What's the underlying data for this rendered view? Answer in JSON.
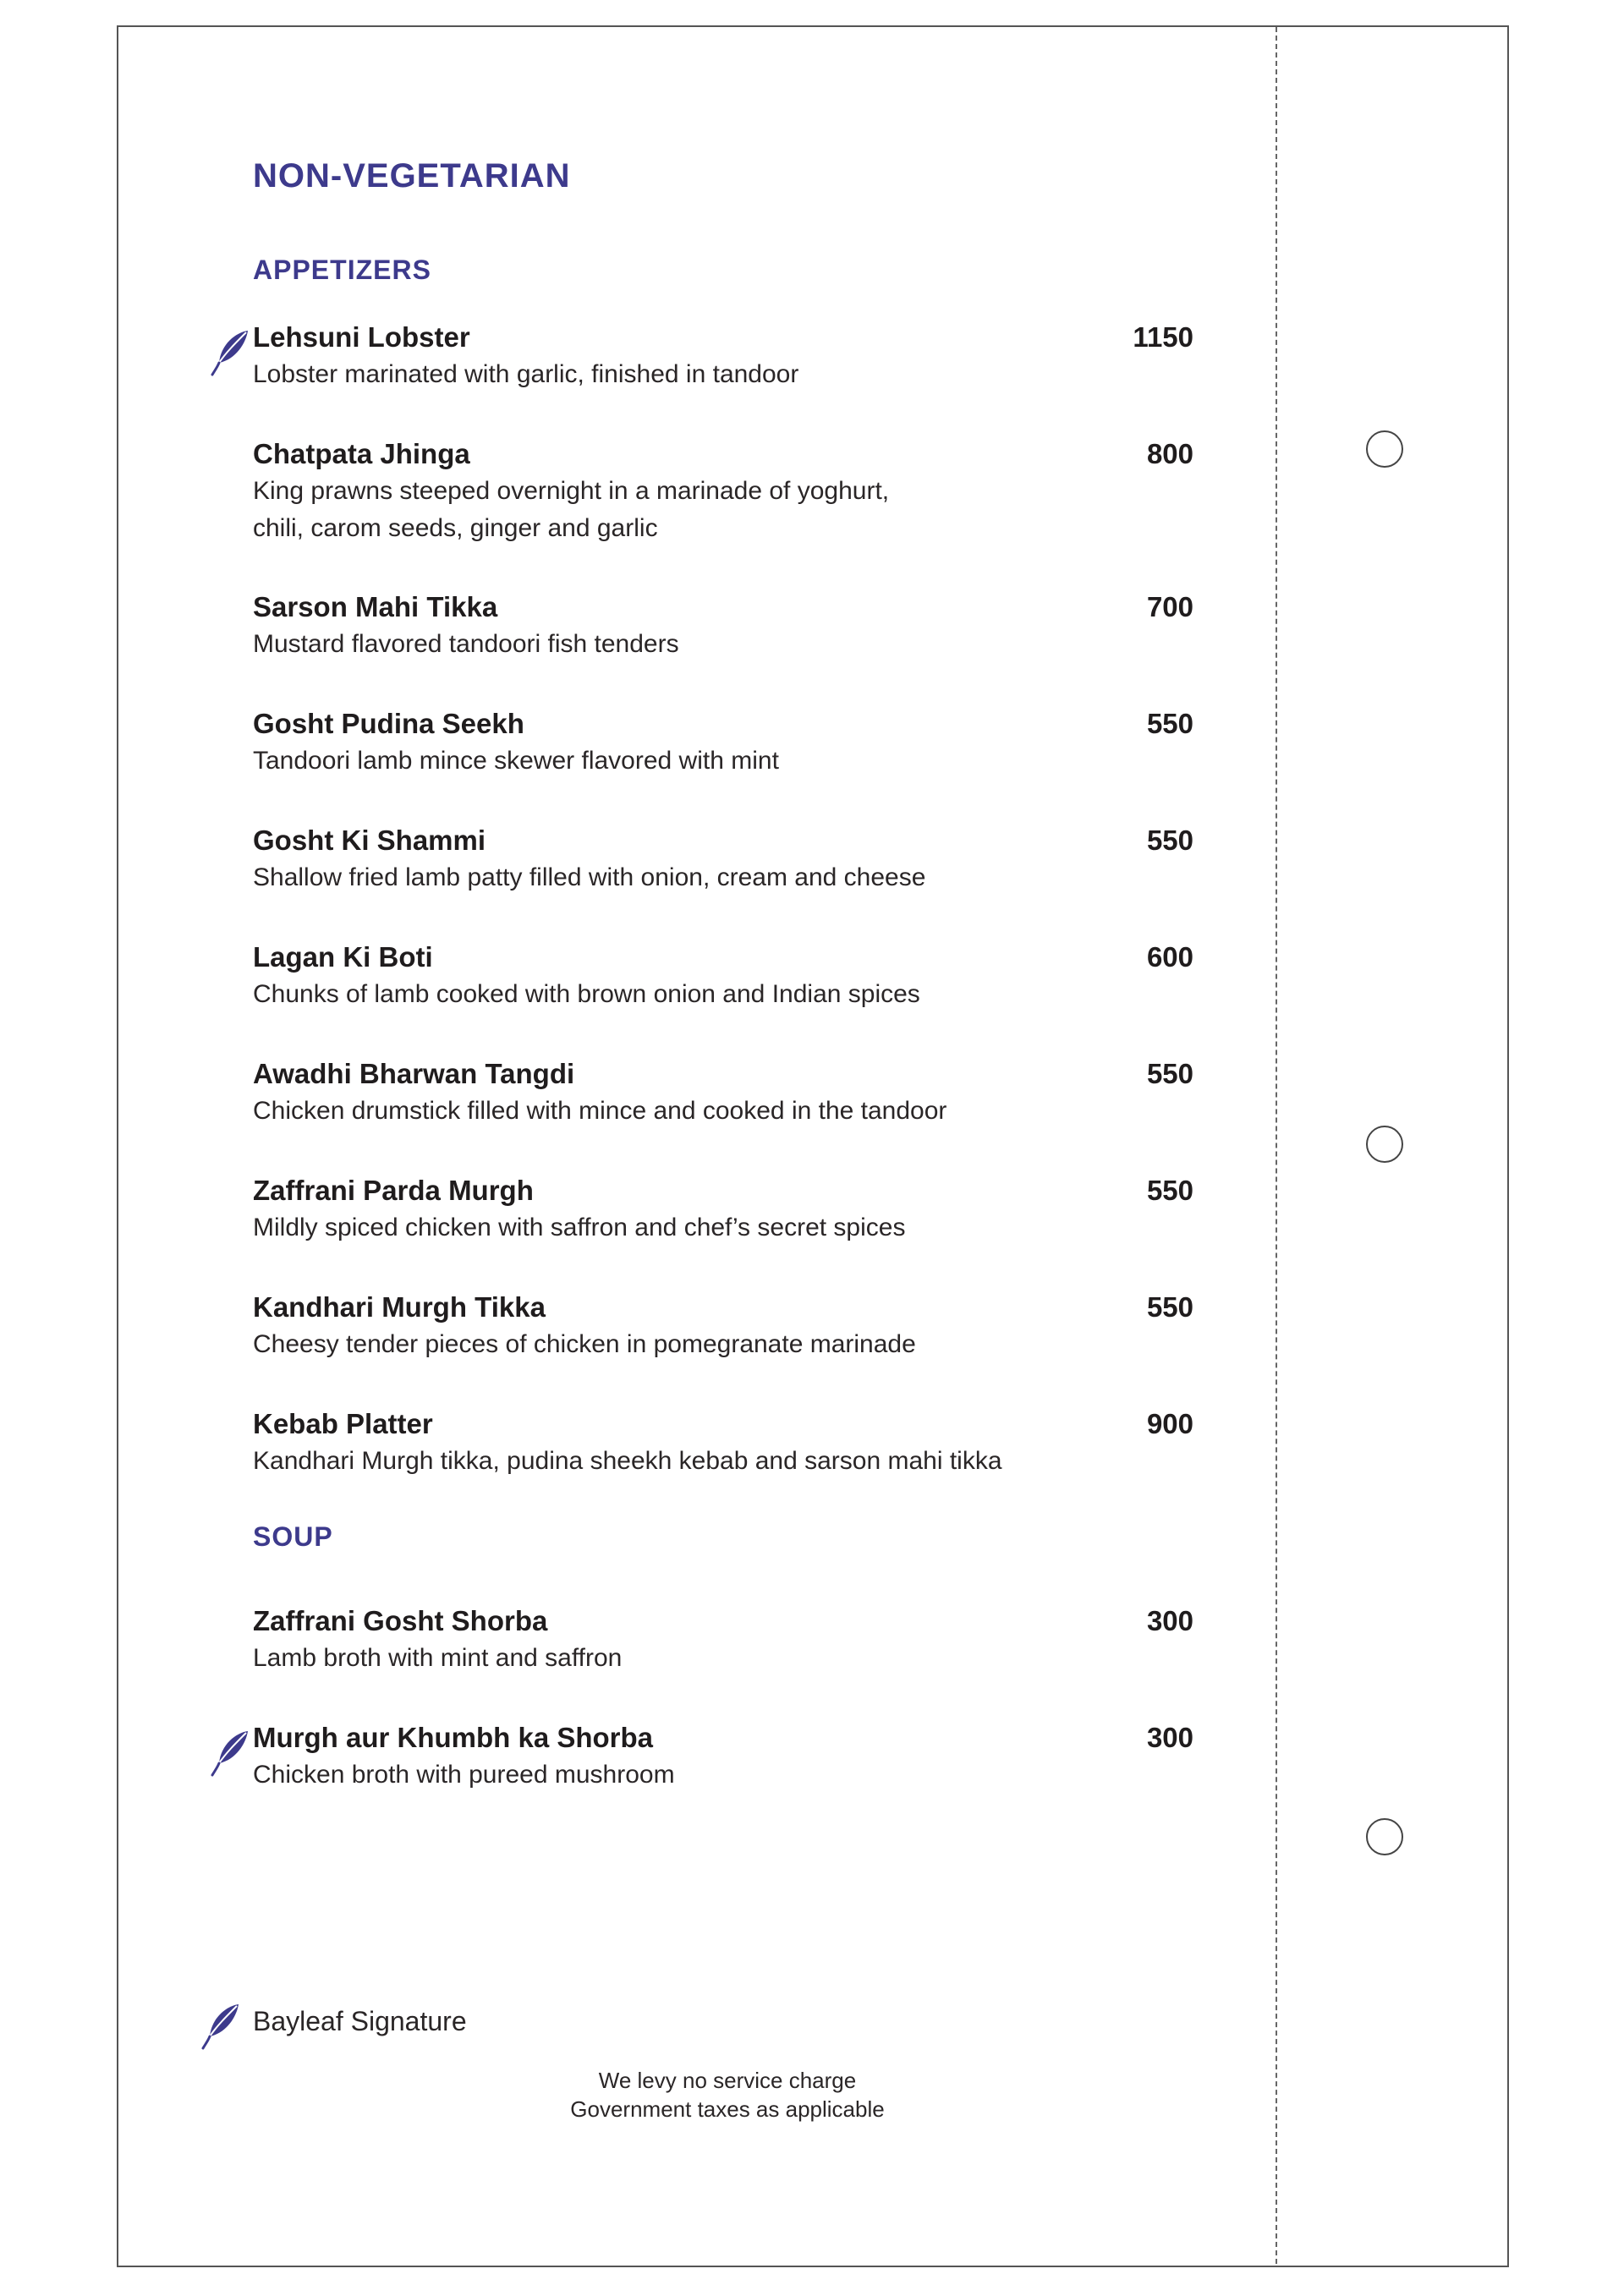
{
  "menu": {
    "title": "NON-VEGETARIAN",
    "sections": [
      {
        "heading": "APPETIZERS",
        "items": [
          {
            "name": "Lehsuni Lobster",
            "description": "Lobster marinated with garlic, finished in tandoor",
            "price": "1150",
            "signature": true
          },
          {
            "name": "Chatpata Jhinga",
            "description": "King prawns steeped overnight in a marinade of yoghurt,\nchili, carom seeds, ginger and garlic",
            "price": "800",
            "signature": false
          },
          {
            "name": "Sarson Mahi Tikka",
            "description": "Mustard flavored tandoori fish tenders",
            "price": "700",
            "signature": false
          },
          {
            "name": "Gosht Pudina Seekh",
            "description": "Tandoori  lamb mince skewer flavored with mint",
            "price": "550",
            "signature": false
          },
          {
            "name": "Gosht Ki Shammi",
            "description": "Shallow fried lamb patty filled with onion, cream and cheese",
            "price": "550",
            "signature": false
          },
          {
            "name": "Lagan Ki Boti",
            "description": "Chunks of lamb cooked with brown onion and Indian spices",
            "price": "600",
            "signature": false
          },
          {
            "name": "Awadhi Bharwan Tangdi",
            "description": "Chicken drumstick filled with mince and cooked in the tandoor",
            "price": "550",
            "signature": false
          },
          {
            "name": "Zaffrani Parda Murgh",
            "description": "Mildly spiced chicken with saffron and chef’s secret spices",
            "price": "550",
            "signature": false
          },
          {
            "name": "Kandhari Murgh Tikka",
            "description": "Cheesy tender pieces of chicken in pomegranate marinade",
            "price": "550",
            "signature": false
          },
          {
            "name": "Kebab Platter",
            "description": "Kandhari Murgh tikka, pudina sheekh kebab and sarson mahi tikka",
            "price": "900",
            "signature": false
          }
        ]
      },
      {
        "heading": "SOUP",
        "items": [
          {
            "name": "Zaffrani Gosht Shorba",
            "description": "Lamb broth with mint and saffron",
            "price": "300",
            "signature": false
          },
          {
            "name": "Murgh aur Khumbh ka Shorba",
            "description": "Chicken broth with pureed mushroom",
            "price": "300",
            "signature": true
          }
        ]
      }
    ],
    "legend": {
      "icon": "bayleaf-icon",
      "label": "Bayleaf Signature"
    },
    "footer": {
      "line1": "We levy no service charge",
      "line2": "Government taxes as applicable"
    },
    "colors": {
      "accent": "#3d3a8c",
      "text": "#231f20",
      "border": "#555555"
    }
  }
}
